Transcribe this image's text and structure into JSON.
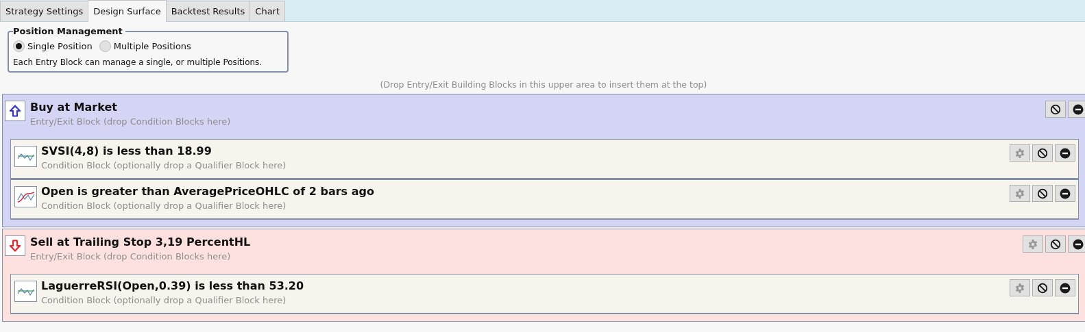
{
  "tabs": [
    {
      "label": "Strategy Settings",
      "selected": false
    },
    {
      "label": "Design Surface",
      "selected": true
    },
    {
      "label": "Backtest Results",
      "selected": false
    },
    {
      "label": "Chart",
      "selected": false
    }
  ],
  "position_management": {
    "title": "Position Management",
    "options": [
      {
        "label": "Single Position",
        "selected": true
      },
      {
        "label": "Multiple Positions",
        "selected": false
      }
    ],
    "description": "Each Entry Block can manage a single, or multiple Positions."
  },
  "drop_hint": "(Drop Entry/Exit Building Blocks in this upper area to insert them at the top)",
  "blocks": [
    {
      "kind": "buy",
      "title": "Buy at Market",
      "subtitle": "Entry/Exit Block (drop Condition Blocks here)",
      "settings": false,
      "conditions": [
        {
          "kind": "oscillator",
          "title": "SVSI(4,8) is less than 18.99",
          "subtitle": "Condition Block (optionally drop a Qualifier Block here)"
        },
        {
          "kind": "crossover",
          "title": "Open is greater than AveragePriceOHLC of 2 bars ago",
          "subtitle": "Condition Block (optionally drop a Qualifier Block here)"
        }
      ]
    },
    {
      "kind": "sell",
      "title": "Sell at Trailing Stop 3,19 PercentHL",
      "subtitle": "Entry/Exit Block (drop Condition Blocks here)",
      "settings": true,
      "conditions": [
        {
          "kind": "oscillator",
          "title": "LaguerreRSI(Open,0.39) is less than 53.20",
          "subtitle": "Condition Block (optionally drop a Qualifier Block here)"
        }
      ]
    }
  ]
}
